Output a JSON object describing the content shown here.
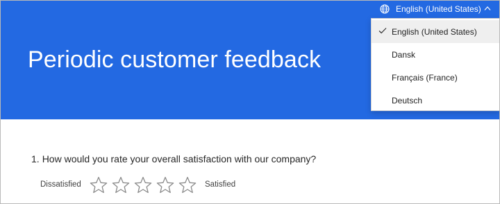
{
  "form": {
    "title": "Periodic customer feedback"
  },
  "language": {
    "current": "English (United States)",
    "icon": "globe-icon",
    "chevron_icon": "chevron-up-icon",
    "options": [
      {
        "label": "English (United States)",
        "selected": true
      },
      {
        "label": "Dansk",
        "selected": false
      },
      {
        "label": "Français (France)",
        "selected": false
      },
      {
        "label": "Deutsch",
        "selected": false
      }
    ]
  },
  "question": {
    "number": "1.",
    "text": "How would you rate your overall satisfaction with our company?",
    "low_label": "Dissatisfied",
    "high_label": "Satisfied",
    "rating": 0,
    "max_rating": 5
  },
  "colors": {
    "header": "#2369e2",
    "star_outline": "#8a8a8a"
  }
}
